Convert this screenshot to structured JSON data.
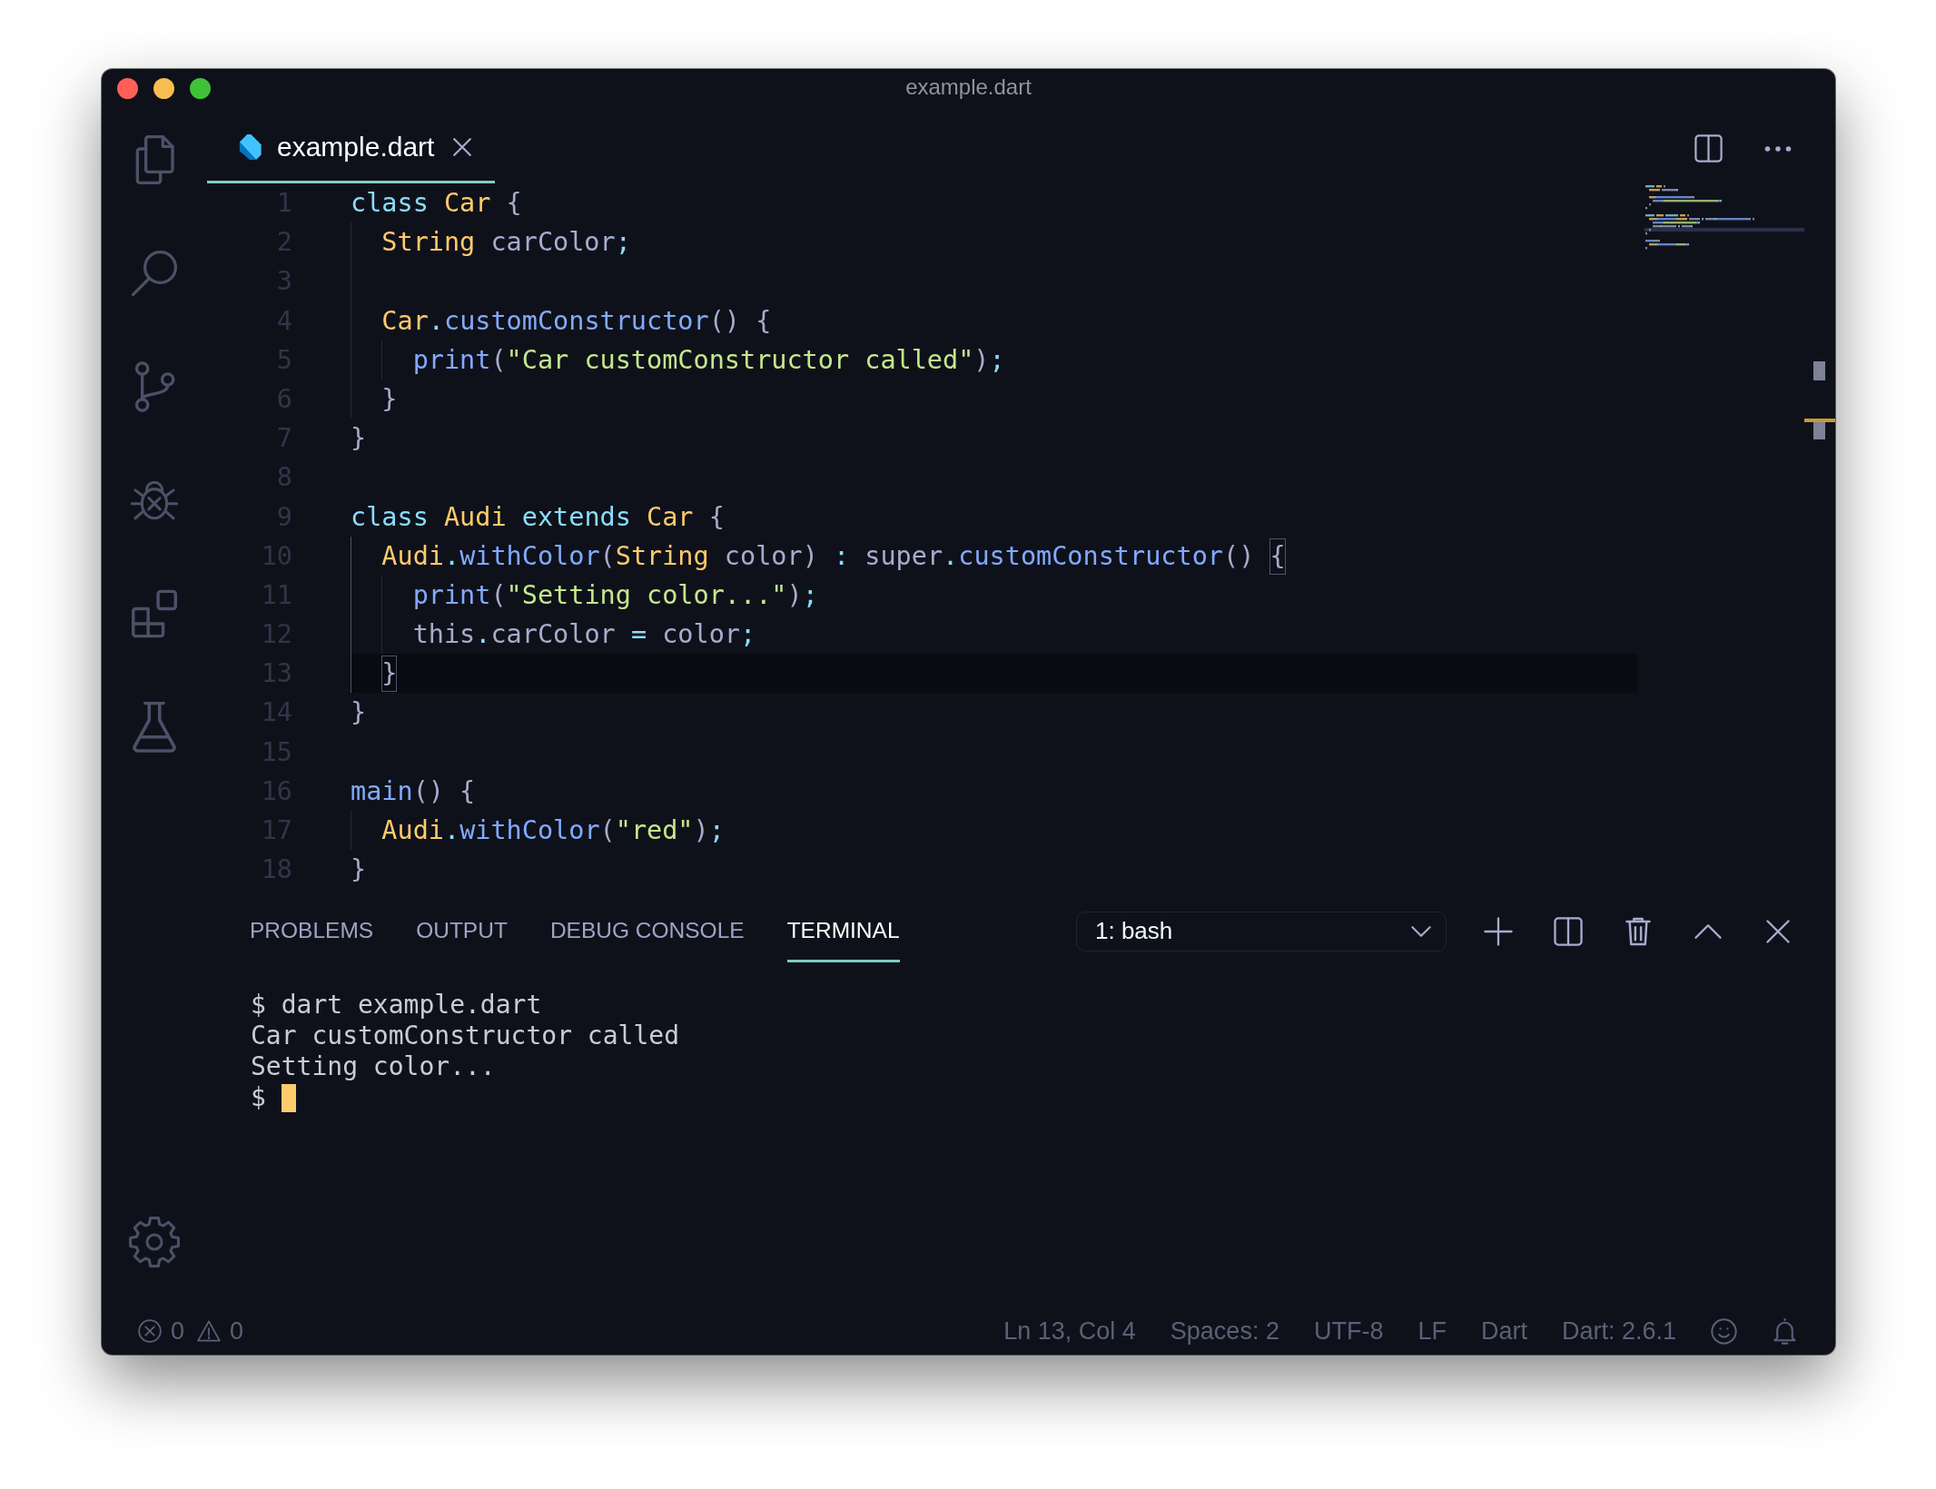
{
  "window": {
    "title": "example.dart"
  },
  "editor": {
    "tabs": [
      {
        "label": "example.dart",
        "selected": true
      }
    ],
    "lines": [
      {
        "number": "1",
        "current": false,
        "tokens": [
          {
            "text": "class ",
            "kind": "keyword"
          },
          {
            "text": "Car",
            "kind": "type"
          },
          {
            "text": " {",
            "kind": "plain"
          }
        ],
        "children": [
          {
            "number": "2",
            "current": false,
            "tokens": [
              {
                "text": "String",
                "kind": "type"
              },
              {
                "text": " carColor",
                "kind": "plain"
              },
              {
                "text": ";",
                "kind": "punctuation"
              }
            ]
          },
          {
            "number": "3",
            "current": false
          },
          {
            "number": "4",
            "current": false,
            "tokens": [
              {
                "text": "Car",
                "kind": "type"
              },
              {
                "text": ".",
                "kind": "punctuation"
              },
              {
                "text": "customConstructor",
                "kind": "function"
              },
              {
                "text": "() {",
                "kind": "plain"
              }
            ],
            "children": [
              {
                "number": "5",
                "current": false,
                "tokens": [
                  {
                    "text": "print",
                    "kind": "function"
                  },
                  {
                    "text": "(",
                    "kind": "plain"
                  },
                  {
                    "text": "\"Car customConstructor called\"",
                    "kind": "string"
                  },
                  {
                    "text": ")",
                    "kind": "plain"
                  },
                  {
                    "text": ";",
                    "kind": "punctuation"
                  }
                ]
              }
            ]
          },
          {
            "number": "6",
            "current": false,
            "tokens": [
              {
                "text": "}",
                "kind": "plain"
              }
            ]
          }
        ]
      },
      {
        "number": "7",
        "current": false,
        "tokens": [
          {
            "text": "}",
            "kind": "plain"
          }
        ]
      },
      {
        "number": "8",
        "current": false
      },
      {
        "number": "9",
        "current": false,
        "tokens": [
          {
            "text": "class ",
            "kind": "keyword"
          },
          {
            "text": "Audi ",
            "kind": "type"
          },
          {
            "text": "extends ",
            "kind": "keyword"
          },
          {
            "text": "Car",
            "kind": "type"
          },
          {
            "text": " {",
            "kind": "plain"
          }
        ],
        "children": [
          {
            "number": "10",
            "current": false,
            "tokens": [
              {
                "text": "Audi",
                "kind": "type"
              },
              {
                "text": ".",
                "kind": "punctuation"
              },
              {
                "text": "withColor",
                "kind": "function"
              },
              {
                "text": "(",
                "kind": "plain"
              },
              {
                "text": "String",
                "kind": "type"
              },
              {
                "text": " color) ",
                "kind": "plain"
              },
              {
                "text": ":",
                "kind": "punctuation"
              },
              {
                "text": " super",
                "kind": "plain"
              },
              {
                "text": ".",
                "kind": "punctuation"
              },
              {
                "text": "customConstructor",
                "kind": "function"
              },
              {
                "text": "() ",
                "kind": "plain"
              },
              {
                "text": "{",
                "kind": "bracket_match"
              }
            ],
            "children": [
              {
                "number": "11",
                "current": false,
                "tokens": [
                  {
                    "text": "print",
                    "kind": "function"
                  },
                  {
                    "text": "(",
                    "kind": "plain"
                  },
                  {
                    "text": "\"Setting color...\"",
                    "kind": "string"
                  },
                  {
                    "text": ")",
                    "kind": "plain"
                  },
                  {
                    "text": ";",
                    "kind": "punctuation"
                  }
                ]
              },
              {
                "number": "12",
                "current": false,
                "tokens": [
                  {
                    "text": "this",
                    "kind": "plain"
                  },
                  {
                    "text": ".",
                    "kind": "punctuation"
                  },
                  {
                    "text": "carColor ",
                    "kind": "plain"
                  },
                  {
                    "text": "=",
                    "kind": "punctuation"
                  },
                  {
                    "text": " color",
                    "kind": "plain"
                  },
                  {
                    "text": ";",
                    "kind": "punctuation"
                  }
                ]
              }
            ]
          },
          {
            "number": "13",
            "current": true,
            "tokens": [
              {
                "text": "}",
                "kind": "bracket_match"
              }
            ]
          }
        ]
      },
      {
        "number": "14",
        "current": false,
        "tokens": [
          {
            "text": "}",
            "kind": "plain"
          }
        ]
      },
      {
        "number": "15",
        "current": false
      },
      {
        "number": "16",
        "current": false,
        "tokens": [
          {
            "text": "main",
            "kind": "function"
          },
          {
            "text": "() {",
            "kind": "plain"
          }
        ],
        "children": [
          {
            "number": "17",
            "current": false,
            "tokens": [
              {
                "text": "Audi",
                "kind": "type"
              },
              {
                "text": ".",
                "kind": "punctuation"
              },
              {
                "text": "withColor",
                "kind": "function"
              },
              {
                "text": "(",
                "kind": "plain"
              },
              {
                "text": "\"red\"",
                "kind": "string"
              },
              {
                "text": ")",
                "kind": "plain"
              },
              {
                "text": ";",
                "kind": "punctuation"
              }
            ]
          }
        ]
      },
      {
        "number": "18",
        "current": false,
        "tokens": [
          {
            "text": "}",
            "kind": "plain"
          }
        ]
      }
    ]
  },
  "panel": {
    "tabs": [
      {
        "label": "PROBLEMS",
        "selected": false
      },
      {
        "label": "OUTPUT",
        "selected": false
      },
      {
        "label": "DEBUG CONSOLE",
        "selected": false
      },
      {
        "label": "TERMINAL",
        "selected": true
      }
    ],
    "terminal_picker": {
      "value": "1: bash"
    },
    "terminal": {
      "lines": [
        "$ dart example.dart",
        "Car customConstructor called",
        "Setting color...",
        "$"
      ]
    }
  },
  "status_bar": {
    "errors": "0",
    "warnings": "0",
    "items": [
      "Ln 13, Col 4",
      "Spaces: 2",
      "UTF-8",
      "LF",
      "Dart",
      "Dart: 2.6.1"
    ]
  }
}
